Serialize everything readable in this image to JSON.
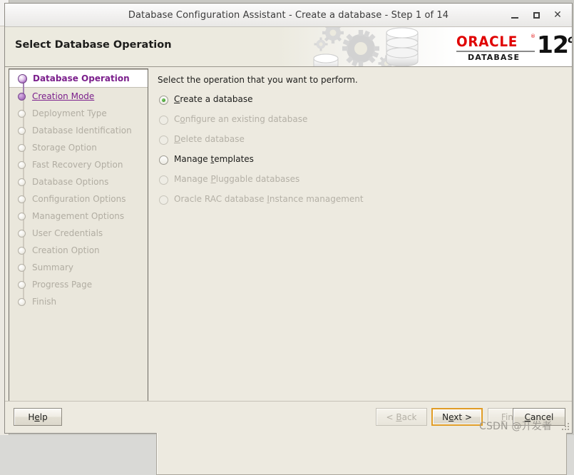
{
  "window": {
    "title": "Database Configuration Assistant - Create a database - Step 1 of 14",
    "controls": {
      "minimize": "minimize-icon",
      "maximize": "maximize-icon",
      "close": "close-icon"
    }
  },
  "header": {
    "title": "Select Database Operation",
    "logo": {
      "brand": "ORACLE",
      "trademark": "®",
      "product": "DATABASE",
      "version": "12",
      "edition": "c"
    }
  },
  "sidebar": {
    "items": [
      {
        "label": "Database Operation",
        "state": "current"
      },
      {
        "label": "Creation Mode",
        "state": "visited"
      },
      {
        "label": "Deployment Type",
        "state": "pending"
      },
      {
        "label": "Database Identification",
        "state": "pending"
      },
      {
        "label": "Storage Option",
        "state": "pending"
      },
      {
        "label": "Fast Recovery Option",
        "state": "pending"
      },
      {
        "label": "Database Options",
        "state": "pending"
      },
      {
        "label": "Configuration Options",
        "state": "pending"
      },
      {
        "label": "Management Options",
        "state": "pending"
      },
      {
        "label": "User Credentials",
        "state": "pending"
      },
      {
        "label": "Creation Option",
        "state": "pending"
      },
      {
        "label": "Summary",
        "state": "pending"
      },
      {
        "label": "Progress Page",
        "state": "pending"
      },
      {
        "label": "Finish",
        "state": "pending"
      }
    ]
  },
  "content": {
    "prompt": "Select the operation that you want to perform.",
    "options": [
      {
        "pre": "",
        "mnemonic": "C",
        "post": "reate a database",
        "selected": true,
        "enabled": true
      },
      {
        "pre": "C",
        "mnemonic": "o",
        "post": "nfigure an existing database",
        "selected": false,
        "enabled": false
      },
      {
        "pre": "",
        "mnemonic": "D",
        "post": "elete database",
        "selected": false,
        "enabled": false
      },
      {
        "pre": "Manage ",
        "mnemonic": "t",
        "post": "emplates",
        "selected": false,
        "enabled": true
      },
      {
        "pre": "Manage ",
        "mnemonic": "P",
        "post": "luggable databases",
        "selected": false,
        "enabled": false
      },
      {
        "pre": "Oracle RAC database ",
        "mnemonic": "I",
        "post": "nstance management",
        "selected": false,
        "enabled": false
      }
    ],
    "message": ""
  },
  "footer": {
    "help": {
      "pre": "H",
      "mnemonic": "e",
      "post": "lp",
      "enabled": true,
      "focused": false
    },
    "back": {
      "pre": "< ",
      "mnemonic": "B",
      "post": "ack",
      "enabled": false,
      "focused": false
    },
    "next": {
      "pre": "N",
      "mnemonic": "e",
      "post": "xt >",
      "enabled": true,
      "focused": true
    },
    "finish": {
      "pre": "",
      "mnemonic": "F",
      "post": "inish",
      "enabled": false,
      "focused": false
    },
    "cancel": {
      "pre": "",
      "mnemonic": "C",
      "post": "ancel",
      "enabled": true,
      "focused": false
    }
  },
  "watermark": {
    "text": "CSDN @开发者"
  },
  "colors": {
    "window_background": "#edeae0",
    "header_background": "#eceadf",
    "accent_purple": "#7b1f8c",
    "oracle_red": "#e00000",
    "focus_gold": "#e09c26",
    "selected_radio_green": "#3f9b2e"
  }
}
